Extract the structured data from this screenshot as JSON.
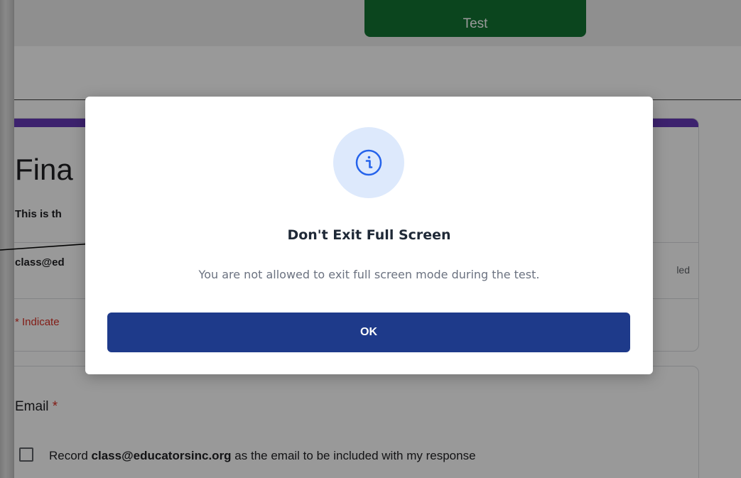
{
  "header": {
    "start_button_label": "Test"
  },
  "form": {
    "title": "Fina",
    "description": "This is th",
    "account_email": "class@ed",
    "account_suffix": "led",
    "required_note": "* Indicate"
  },
  "email_question": {
    "label": "Email",
    "required_mark": "*",
    "checkbox_prefix": "Record ",
    "checkbox_email": "class@educatorsinc.org",
    "checkbox_suffix": " as the email to be included with my response",
    "checked": false
  },
  "modal": {
    "icon": "info-icon",
    "title": "Don't Exit Full Screen",
    "message": "You are not allowed to exit full screen mode during the test.",
    "ok_label": "OK"
  },
  "colors": {
    "start_button": "#137333",
    "form_accent": "#673ab7",
    "required": "#d93025",
    "ok_button": "#1e3a8a",
    "icon_circle": "#dde9fc"
  }
}
